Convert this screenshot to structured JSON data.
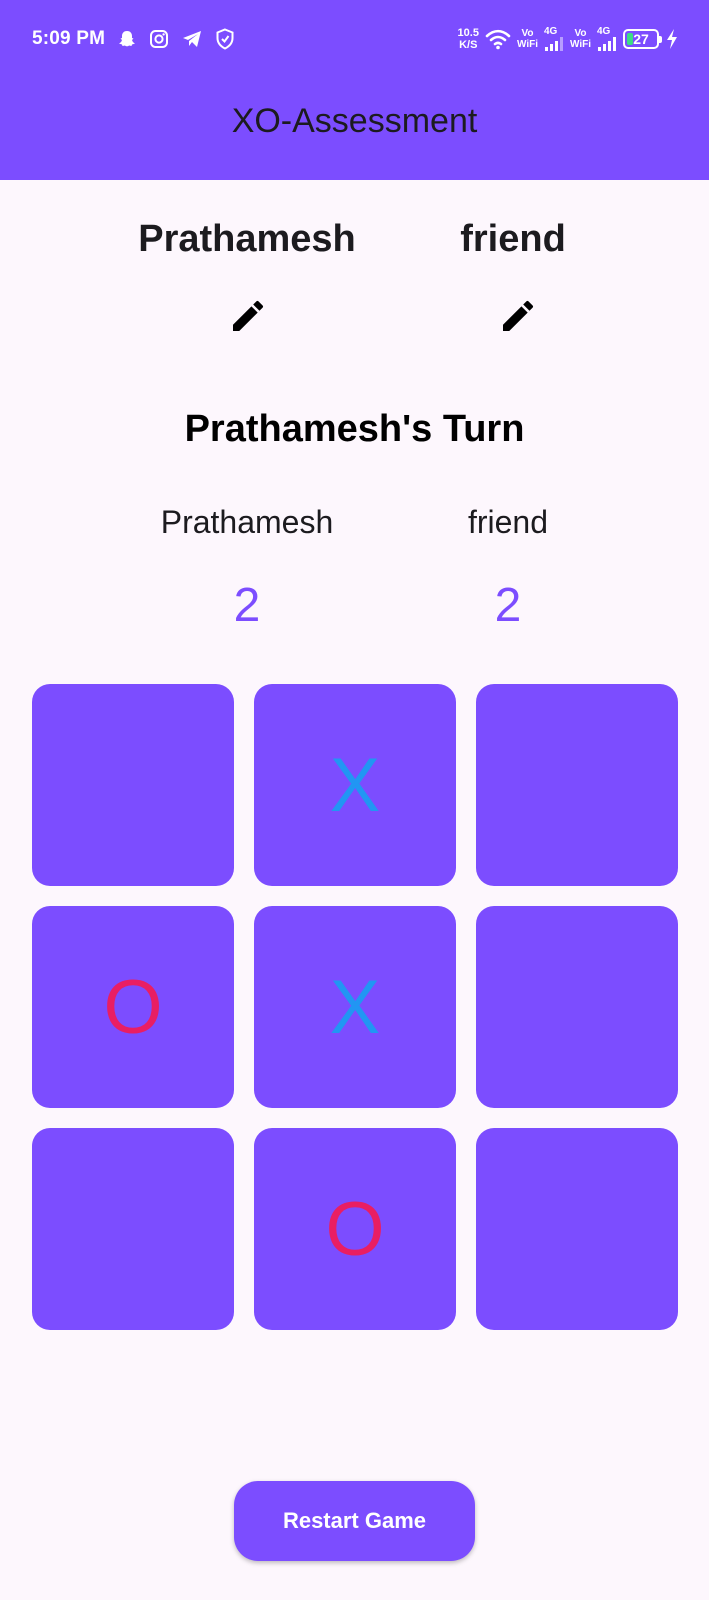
{
  "status_bar": {
    "time": "5:09 PM",
    "net_speed_value": "10.5",
    "net_speed_unit": "K/S",
    "sim1_top": "Vo",
    "sim1_bottom": "WiFi",
    "sim1_network": "4G",
    "sim2_top": "Vo",
    "sim2_bottom": "WiFi",
    "sim2_network": "4G",
    "battery_level": "27",
    "icons": [
      "snapchat-icon",
      "instagram-icon",
      "telegram-icon",
      "shield-icon",
      "wifi-icon",
      "signal-icon",
      "charging-icon"
    ]
  },
  "app_bar": {
    "title": "XO-Assessment"
  },
  "players": [
    {
      "name": "Prathamesh",
      "edit_icon": "pencil-icon"
    },
    {
      "name": "friend",
      "edit_icon": "pencil-icon"
    }
  ],
  "turn": {
    "text": "Prathamesh's Turn"
  },
  "scoreboard": [
    {
      "name": "Prathamesh",
      "score": "2"
    },
    {
      "name": "friend",
      "score": "2"
    }
  ],
  "board": {
    "cells": [
      "",
      "X",
      "",
      "O",
      "X",
      "",
      "",
      "O",
      ""
    ]
  },
  "controls": {
    "restart_label": "Restart Game"
  },
  "colors": {
    "primary": "#7c4dff",
    "background": "#fdf7fd",
    "x_mark": "#2196f3",
    "o_mark": "#e91e63",
    "battery_fill": "#3ddc84"
  }
}
